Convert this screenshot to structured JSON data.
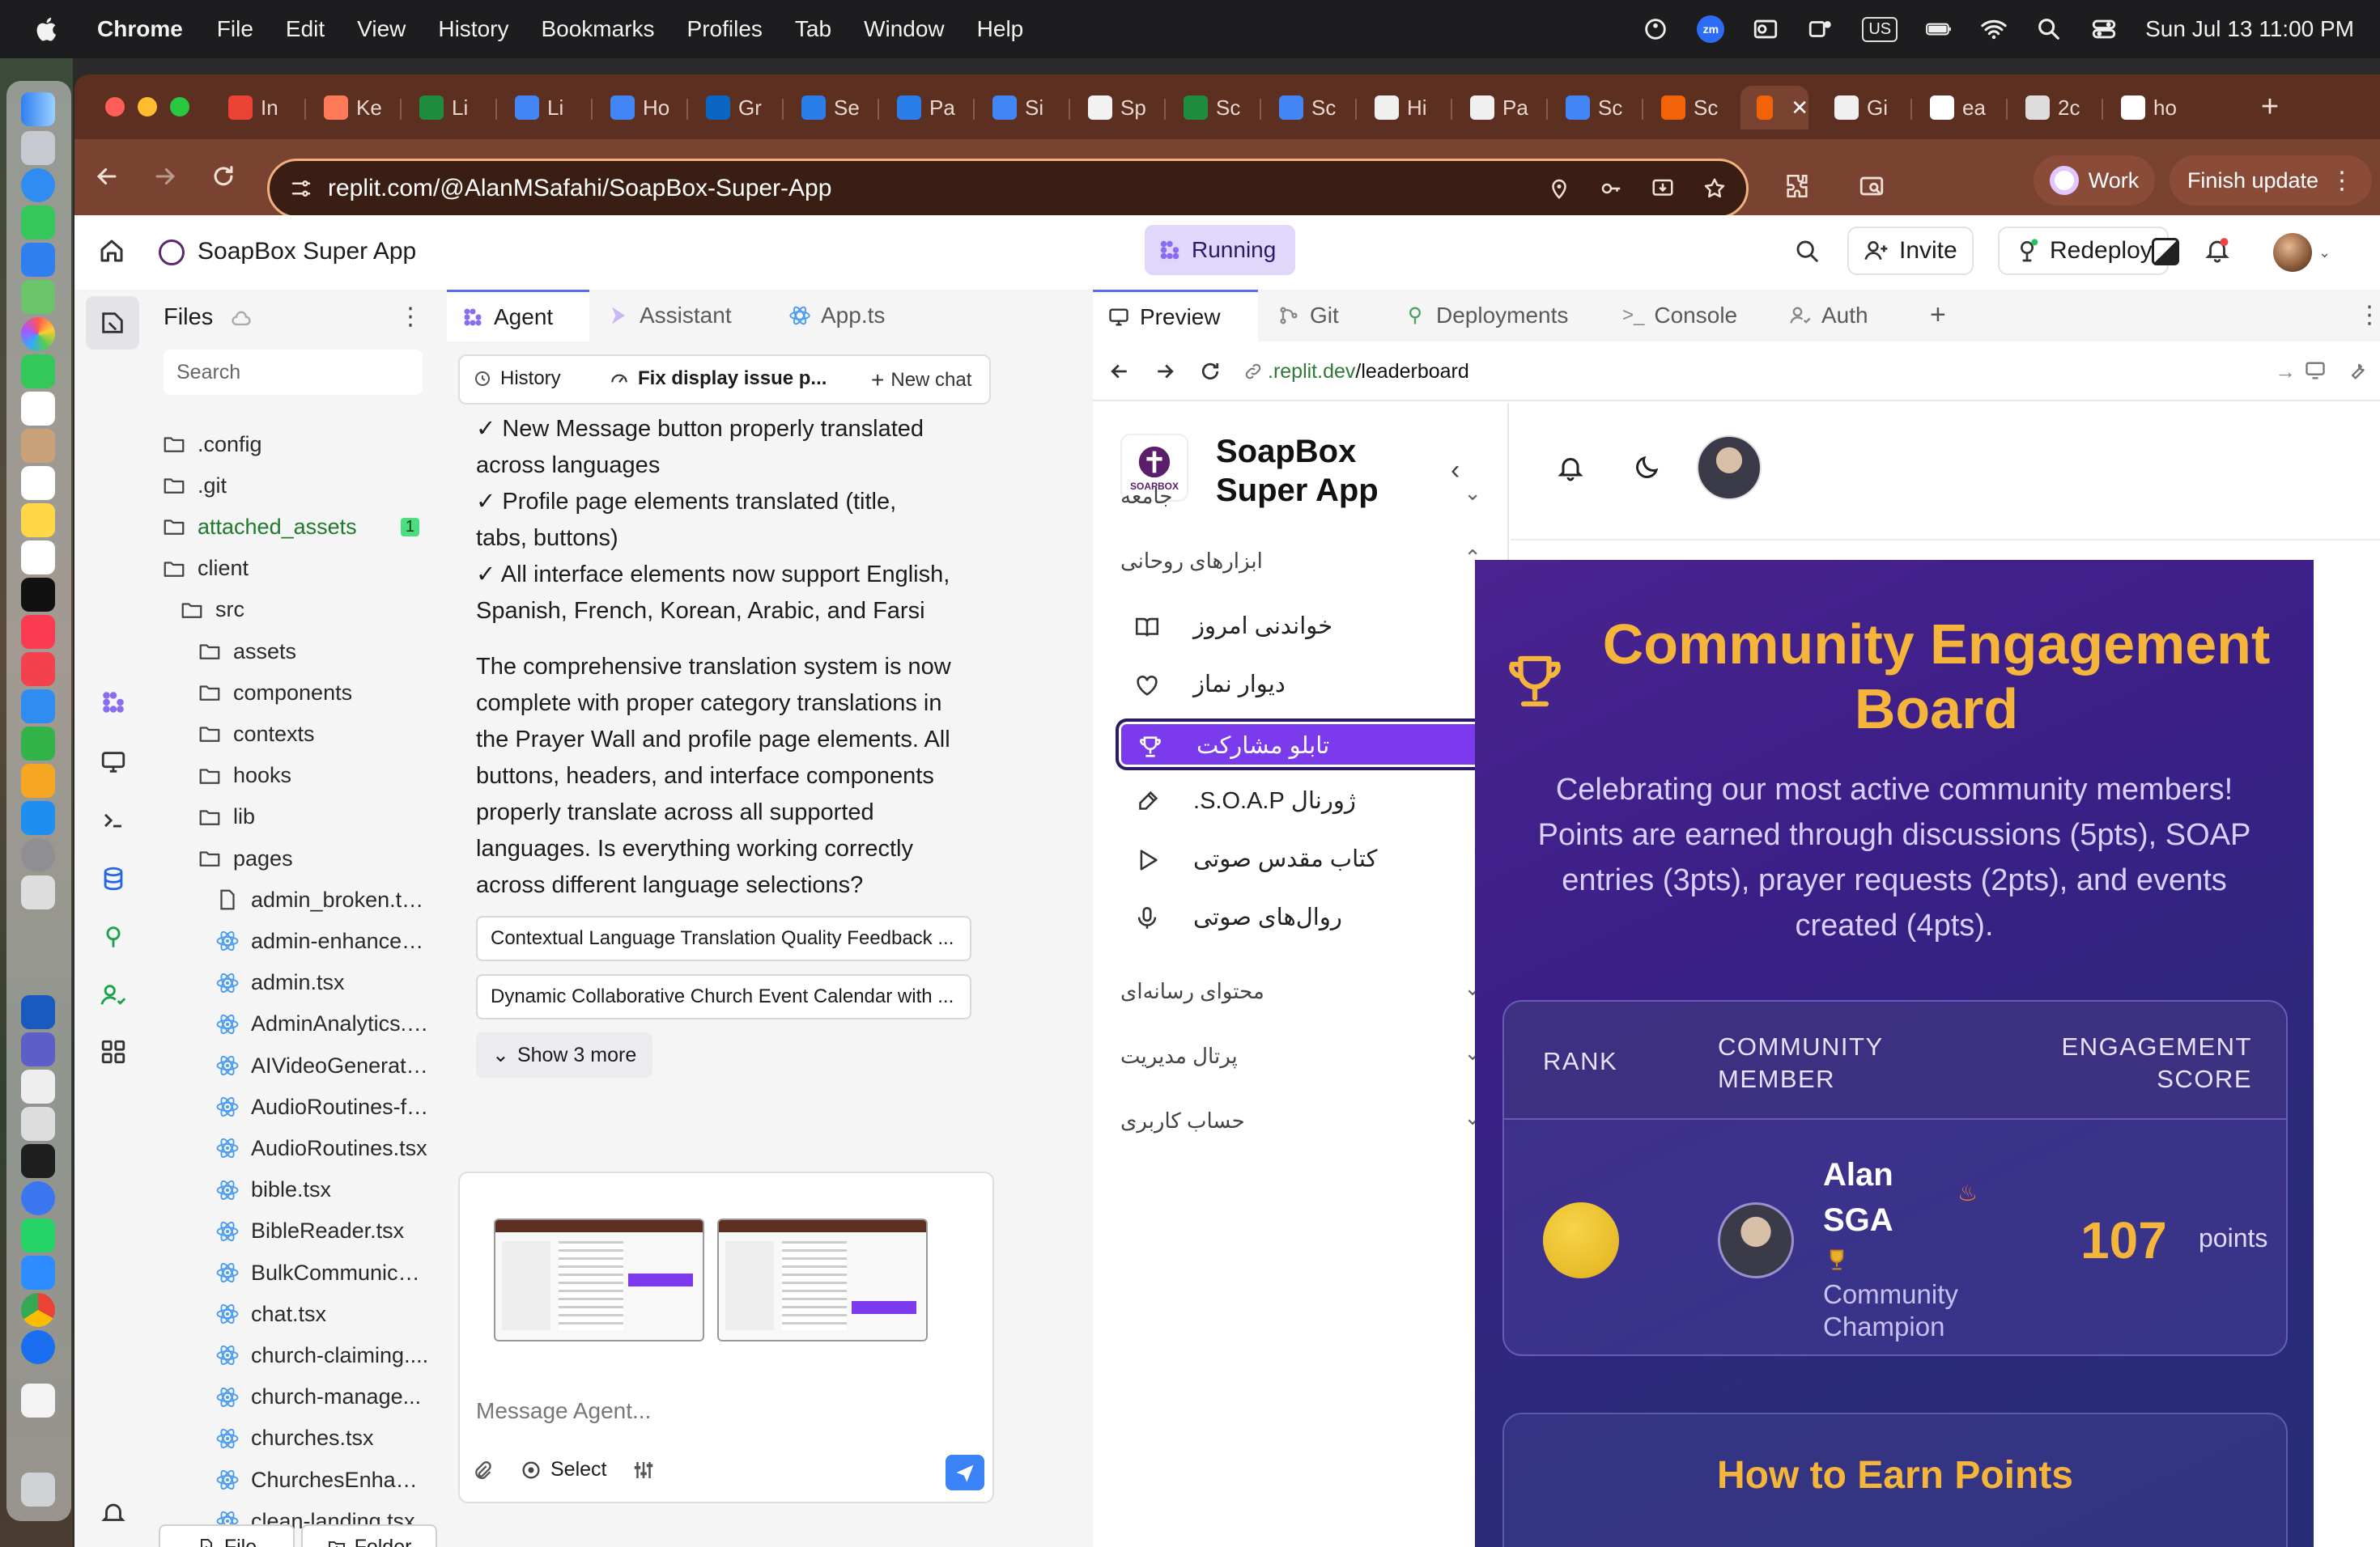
{
  "menubar": {
    "app": "Chrome",
    "items": [
      "File",
      "Edit",
      "View",
      "History",
      "Bookmarks",
      "Profiles",
      "Tab",
      "Window",
      "Help"
    ],
    "zoom_badge": "zm",
    "input_source": "US",
    "clock": "Sun Jul 13  11:00 PM"
  },
  "browser": {
    "tabs": [
      {
        "favicon": "gmail-icon",
        "title": "In",
        "color": "#ea4335"
      },
      {
        "favicon": "hubspot-icon",
        "title": "Ke",
        "color": "#ff7a59"
      },
      {
        "favicon": "sheets-icon",
        "title": "Li",
        "color": "#1e8e3e"
      },
      {
        "favicon": "docs-icon",
        "title": "Li",
        "color": "#4285f4"
      },
      {
        "favicon": "docs-icon",
        "title": "Ho",
        "color": "#4285f4"
      },
      {
        "favicon": "linkedin-icon",
        "title": "Gr",
        "color": "#0a66c2"
      },
      {
        "favicon": "safari-icon",
        "title": "Se",
        "color": "#2b7de9"
      },
      {
        "favicon": "safari-icon",
        "title": "Pa",
        "color": "#2b7de9"
      },
      {
        "favicon": "docs-icon",
        "title": "Si",
        "color": "#4285f4"
      },
      {
        "favicon": "slides-icon",
        "title": "Sp",
        "color": "#f2f2f2"
      },
      {
        "favicon": "sheets-icon",
        "title": "Sc",
        "color": "#1e8e3e"
      },
      {
        "favicon": "docs-icon",
        "title": "Sc",
        "color": "#4285f4"
      },
      {
        "favicon": "openai-icon",
        "title": "Hi",
        "color": "#f0f0f0"
      },
      {
        "favicon": "github-icon",
        "title": "Pa",
        "color": "#f0f0f0"
      },
      {
        "favicon": "docs-icon",
        "title": "Sc",
        "color": "#4285f4"
      },
      {
        "favicon": "replit-icon",
        "title": "Sc",
        "color": "#f26207"
      },
      {
        "favicon": "replit-icon",
        "title": "",
        "color": "#f26207",
        "active": true
      },
      {
        "favicon": "github-icon",
        "title": "Gi",
        "color": "#f0f0f0"
      },
      {
        "favicon": "google-icon",
        "title": "ea",
        "color": "#fff"
      },
      {
        "favicon": "globe-icon",
        "title": "2c",
        "color": "#ddd"
      },
      {
        "favicon": "google-icon",
        "title": "ho",
        "color": "#fff"
      }
    ],
    "url": "replit.com/@AlanMSafahi/SoapBox-Super-App",
    "profile_label": "Work",
    "update_label": "Finish update"
  },
  "replit": {
    "project_name": "SoapBox Super App",
    "run_status": "Running",
    "invite_label": "Invite",
    "redeploy_label": "Redeploy",
    "files": {
      "title": "Files",
      "search_placeholder": "Search",
      "tree": [
        {
          "name": ".config",
          "type": "folder",
          "depth": 0
        },
        {
          "name": ".git",
          "type": "folder",
          "depth": 0
        },
        {
          "name": "attached_assets",
          "type": "folder",
          "depth": 0,
          "badge": "1",
          "highlight": true
        },
        {
          "name": "client",
          "type": "folder",
          "depth": 0
        },
        {
          "name": "src",
          "type": "folder",
          "depth": 1
        },
        {
          "name": "assets",
          "type": "folder",
          "depth": 2
        },
        {
          "name": "components",
          "type": "folder",
          "depth": 2
        },
        {
          "name": "contexts",
          "type": "folder",
          "depth": 2
        },
        {
          "name": "hooks",
          "type": "folder",
          "depth": 2
        },
        {
          "name": "lib",
          "type": "folder",
          "depth": 2
        },
        {
          "name": "pages",
          "type": "folder",
          "depth": 2
        },
        {
          "name": "admin_broken.ts...",
          "type": "file",
          "depth": 3
        },
        {
          "name": "admin-enhanced...",
          "type": "react",
          "depth": 3
        },
        {
          "name": "admin.tsx",
          "type": "react",
          "depth": 3
        },
        {
          "name": "AdminAnalytics.tsx",
          "type": "react",
          "depth": 3
        },
        {
          "name": "AIVideoGenerato...",
          "type": "react",
          "depth": 3
        },
        {
          "name": "AudioRoutines-fi...",
          "type": "react",
          "depth": 3
        },
        {
          "name": "AudioRoutines.tsx",
          "type": "react",
          "depth": 3
        },
        {
          "name": "bible.tsx",
          "type": "react",
          "depth": 3
        },
        {
          "name": "BibleReader.tsx",
          "type": "react",
          "depth": 3
        },
        {
          "name": "BulkCommunicat...",
          "type": "react",
          "depth": 3
        },
        {
          "name": "chat.tsx",
          "type": "react",
          "depth": 3
        },
        {
          "name": "church-claiming....",
          "type": "react",
          "depth": 3
        },
        {
          "name": "church-manage...",
          "type": "react",
          "depth": 3
        },
        {
          "name": "churches.tsx",
          "type": "react",
          "depth": 3
        },
        {
          "name": "ChurchesEnhanc...",
          "type": "react",
          "depth": 3
        },
        {
          "name": "clean-landing.tsx",
          "type": "react",
          "depth": 3
        }
      ],
      "new_file_label": "File",
      "new_folder_label": "Folder"
    },
    "panel_tabs": [
      "Agent",
      "Assistant",
      "App.ts"
    ],
    "agent": {
      "history_label": "History",
      "thread_title": "Fix display issue p...",
      "new_chat_label": "New chat",
      "messages": [
        "✓ New Message button properly translated across languages",
        "✓ Profile page elements translated (title, tabs, buttons)",
        "✓ All interface elements now support English, Spanish, French, Korean, Arabic, and Farsi",
        "The comprehensive translation system is now complete with proper category translations in the Prayer Wall and profile page elements. All buttons, headers, and interface components properly translate across all supported languages. Is everything working correctly across different language selections?"
      ],
      "suggestions": [
        "Contextual Language Translation Quality Feedback ...",
        "Dynamic Collaborative Church Event Calendar with ..."
      ],
      "show_more_label": "Show 3 more",
      "input_placeholder": "Message Agent...",
      "select_label": "Select"
    },
    "preview_tabs": [
      "Preview",
      "Git",
      "Deployments",
      "Console",
      "Auth"
    ],
    "preview": {
      "url_domain": ".replit.dev",
      "url_path": "/leaderboard",
      "app": {
        "brand_line1": "SoapBox",
        "brand_line2": "Super App",
        "logo_text": "SOAPBOX",
        "nav": [
          {
            "label": "جامعه",
            "type": "section",
            "expanded": false
          },
          {
            "label": "ابزارهای روحانی",
            "type": "section",
            "expanded": true
          },
          {
            "label": "خواندنی امروز",
            "type": "item",
            "icon": "book-icon"
          },
          {
            "label": "دیوار نماز",
            "type": "item",
            "icon": "heart-icon"
          },
          {
            "label": "تابلو مشارکت",
            "type": "item",
            "icon": "trophy-icon",
            "active": true
          },
          {
            "label": "ژورنال S.O.A.P.",
            "type": "item",
            "icon": "pen-icon"
          },
          {
            "label": "کتاب مقدس صوتی",
            "type": "item",
            "icon": "play-icon"
          },
          {
            "label": "روال‌های صوتی",
            "type": "item",
            "icon": "mic-icon"
          },
          {
            "label": "محتوای رسانه‌ای",
            "type": "section",
            "expanded": false
          },
          {
            "label": "پرتال مدیریت",
            "type": "section",
            "expanded": false
          },
          {
            "label": "حساب کاربری",
            "type": "section",
            "expanded": false
          }
        ],
        "board": {
          "title_line1": "Community Engagement",
          "title_line2": "Board",
          "subtitle": "Celebrating our most active community members! Points are earned through discussions (5pts), SOAP entries (3pts), prayer requests (2pts), and events created (4pts).",
          "col_rank": "RANK",
          "col_member_1": "COMMUNITY",
          "col_member_2": "MEMBER",
          "col_score_1": "ENGAGEMENT",
          "col_score_2": "SCORE",
          "top_member": {
            "first_name": "Alan",
            "last_name": "SGA",
            "role_1": "Community",
            "role_2": "Champion",
            "score": "107",
            "unit": "points"
          },
          "how_to_title": "How to Earn Points"
        }
      }
    }
  },
  "colors": {
    "tabstrip": "#5c2f20",
    "toolbar": "#7a4230",
    "accent_purple": "#7c3aed",
    "board_gold": "#f5b53a"
  }
}
